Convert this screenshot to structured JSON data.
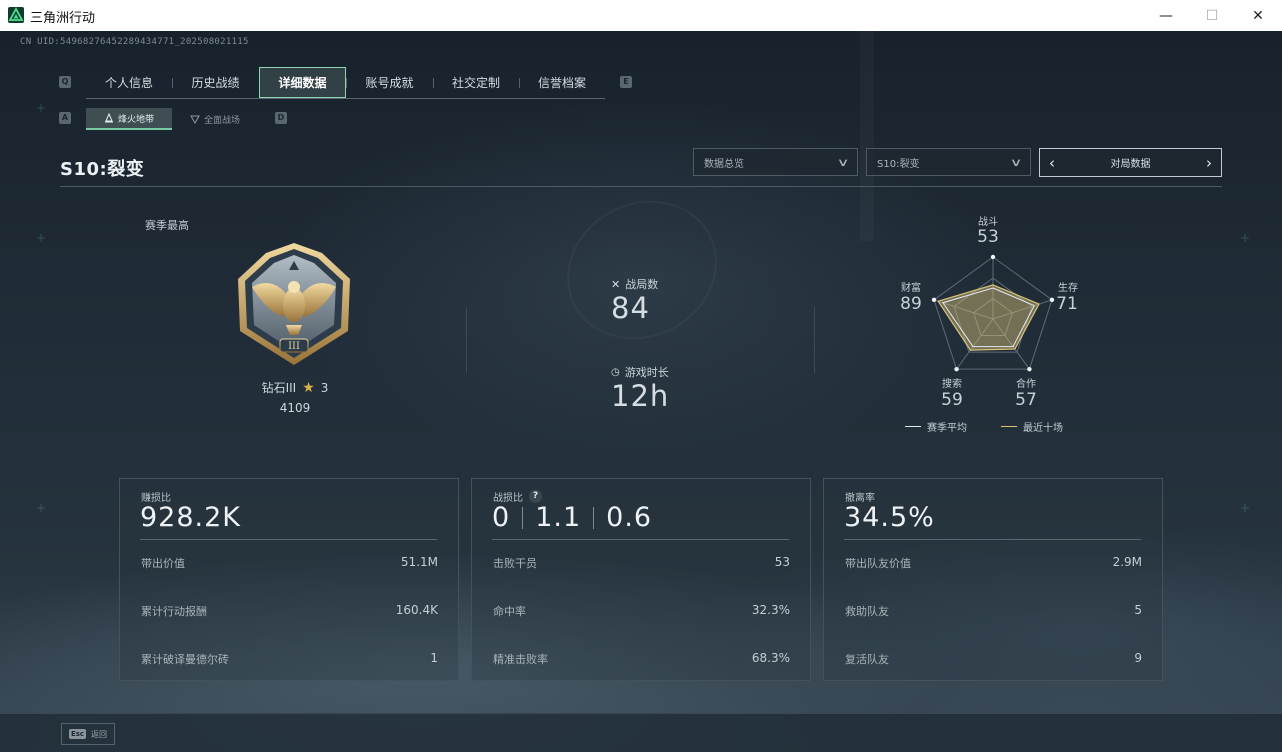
{
  "window": {
    "title": "三角洲行动",
    "min": "—",
    "max": "☐",
    "close": "✕"
  },
  "uid": "CN UID:5496827645228943477​1_202508021115",
  "tabs": {
    "left_key": "Q",
    "right_key": "E",
    "items": [
      {
        "label": "个人信息",
        "active": false
      },
      {
        "label": "历史战绩",
        "active": false
      },
      {
        "label": "详细数据",
        "active": true
      },
      {
        "label": "账号成就",
        "active": false
      },
      {
        "label": "社交定制",
        "active": false
      },
      {
        "label": "信誉档案",
        "active": false
      }
    ]
  },
  "modes": {
    "left_key": "A",
    "right_key": "D",
    "items": [
      {
        "label": "烽火地带",
        "active": true
      },
      {
        "label": "全面战场",
        "active": false
      }
    ]
  },
  "season": {
    "title": "S10:裂变",
    "dropdown_overview": "数据总览",
    "dropdown_season": "S10:裂变",
    "stepper_label": "对局数据"
  },
  "rank": {
    "section_label": "赛季最高",
    "name": "钻石III",
    "stars": "3",
    "points": "4109",
    "numeral": "III"
  },
  "summary": {
    "matches_label": "战局数",
    "matches_value": "84",
    "playtime_label": "游戏时长",
    "playtime_value": "12h"
  },
  "radar": {
    "axes": [
      {
        "label": "战斗",
        "value": "53"
      },
      {
        "label": "生存",
        "value": "71"
      },
      {
        "label": "合作",
        "value": "57"
      },
      {
        "label": "搜索",
        "value": "59"
      },
      {
        "label": "财富",
        "value": "89"
      }
    ],
    "recent_fraction": [
      0.55,
      0.78,
      0.6,
      0.62,
      0.93
    ],
    "average_fraction": [
      0.5,
      0.7,
      0.55,
      0.55,
      0.85
    ],
    "legend_avg": "赛季平均",
    "legend_recent": "最近十场",
    "avg_color": "#e6eaee",
    "recent_color": "#d9c37a"
  },
  "cards": {
    "profit": {
      "label": "赚损比",
      "value": "928.2K",
      "rows": [
        {
          "label": "带出价值",
          "value": "51.1M"
        },
        {
          "label": "累计行动报酬",
          "value": "160.4K"
        },
        {
          "label": "累计破译曼德尔砖",
          "value": "1"
        }
      ]
    },
    "kd": {
      "label": "战损比",
      "help": "?",
      "values": [
        "0",
        "1.1",
        "0.6"
      ],
      "rows": [
        {
          "label": "击败干员",
          "value": "53"
        },
        {
          "label": "命中率",
          "value": "32.3%"
        },
        {
          "label": "精准击败率",
          "value": "68.3%"
        }
      ]
    },
    "extract": {
      "label": "撤离率",
      "value": "34.5%",
      "rows": [
        {
          "label": "带出队友价值",
          "value": "2.9M"
        },
        {
          "label": "救助队友",
          "value": "5"
        },
        {
          "label": "复活队友",
          "value": "9"
        }
      ]
    }
  },
  "footer": {
    "esc_key": "Esc",
    "back_label": "返回"
  },
  "colors": {
    "accent_green": "#79c9a2",
    "gold": "#d7b14a"
  }
}
